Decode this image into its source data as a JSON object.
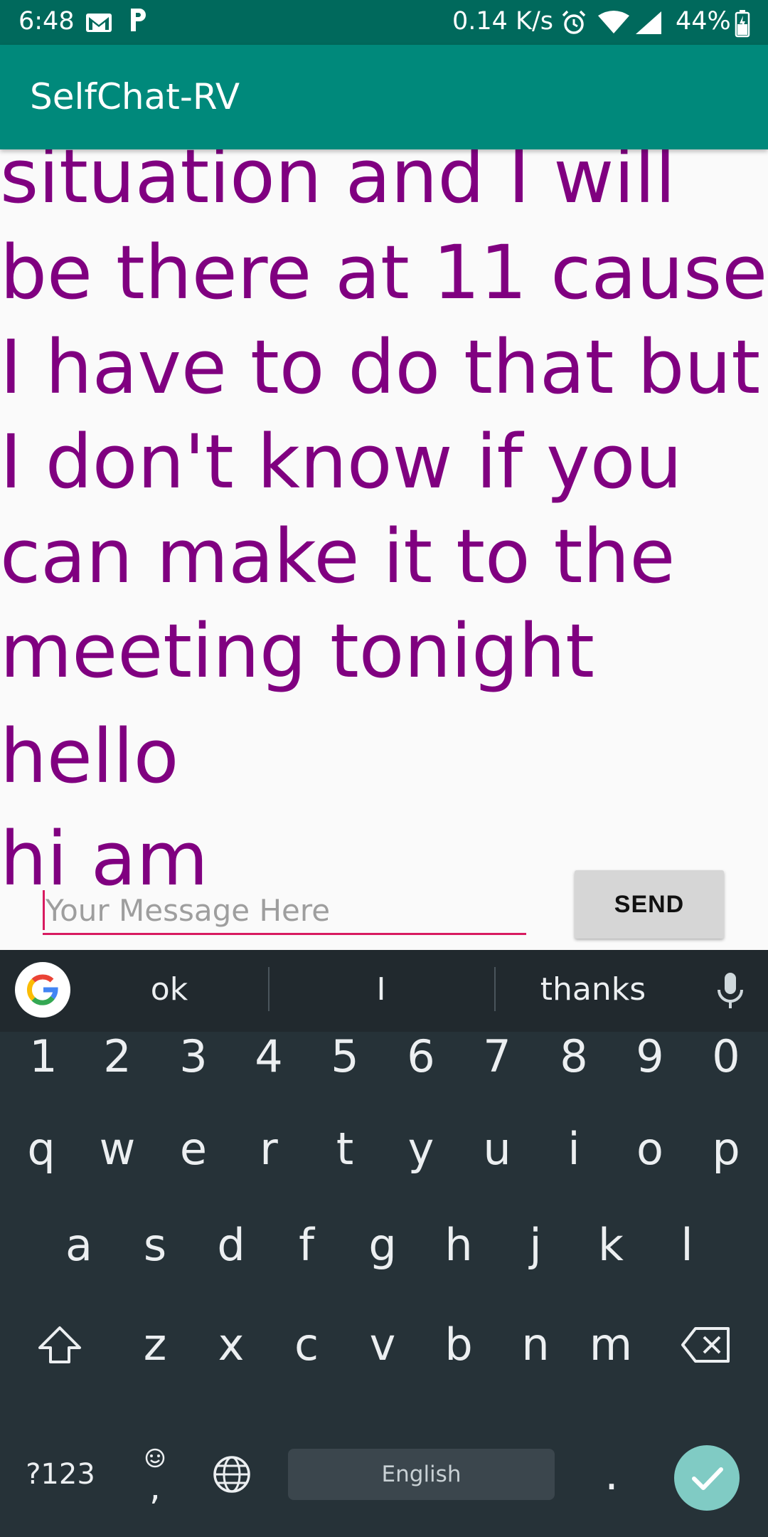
{
  "status_bar": {
    "time": "6:48",
    "network_speed": "0.14 K/s",
    "battery": "44%",
    "icons": [
      "gmail-icon",
      "parking-p-icon",
      "alarm-icon",
      "wifi-icon",
      "signal-icon",
      "battery-icon"
    ]
  },
  "app": {
    "title": "SelfChat-RV"
  },
  "messages": [
    "situation and I will",
    "be there at 11 cause",
    "I have to do that but",
    "I don't know if you",
    "can make it to the",
    "meeting tonight",
    "hello",
    "hi am"
  ],
  "input": {
    "value": "",
    "placeholder": "Your Message Here",
    "send_label": "SEND"
  },
  "keyboard": {
    "suggestions": [
      "ok",
      "I",
      "thanks"
    ],
    "row_numbers": [
      "1",
      "2",
      "3",
      "4",
      "5",
      "6",
      "7",
      "8",
      "9",
      "0"
    ],
    "row1": [
      "q",
      "w",
      "e",
      "r",
      "t",
      "y",
      "u",
      "i",
      "o",
      "p"
    ],
    "row2": [
      "a",
      "s",
      "d",
      "f",
      "g",
      "h",
      "j",
      "k",
      "l"
    ],
    "row3": [
      "z",
      "x",
      "c",
      "v",
      "b",
      "n",
      "m"
    ],
    "symbols_key": "?123",
    "emoji_comma_key": ",",
    "space_label": "English",
    "period_key": ".",
    "colors": {
      "background": "#263238",
      "enter": "#80cbc4"
    }
  },
  "colors": {
    "app_bar": "#00897b",
    "status_bar": "#00695c",
    "message_text": "#800080",
    "input_underline": "#d81b60"
  }
}
